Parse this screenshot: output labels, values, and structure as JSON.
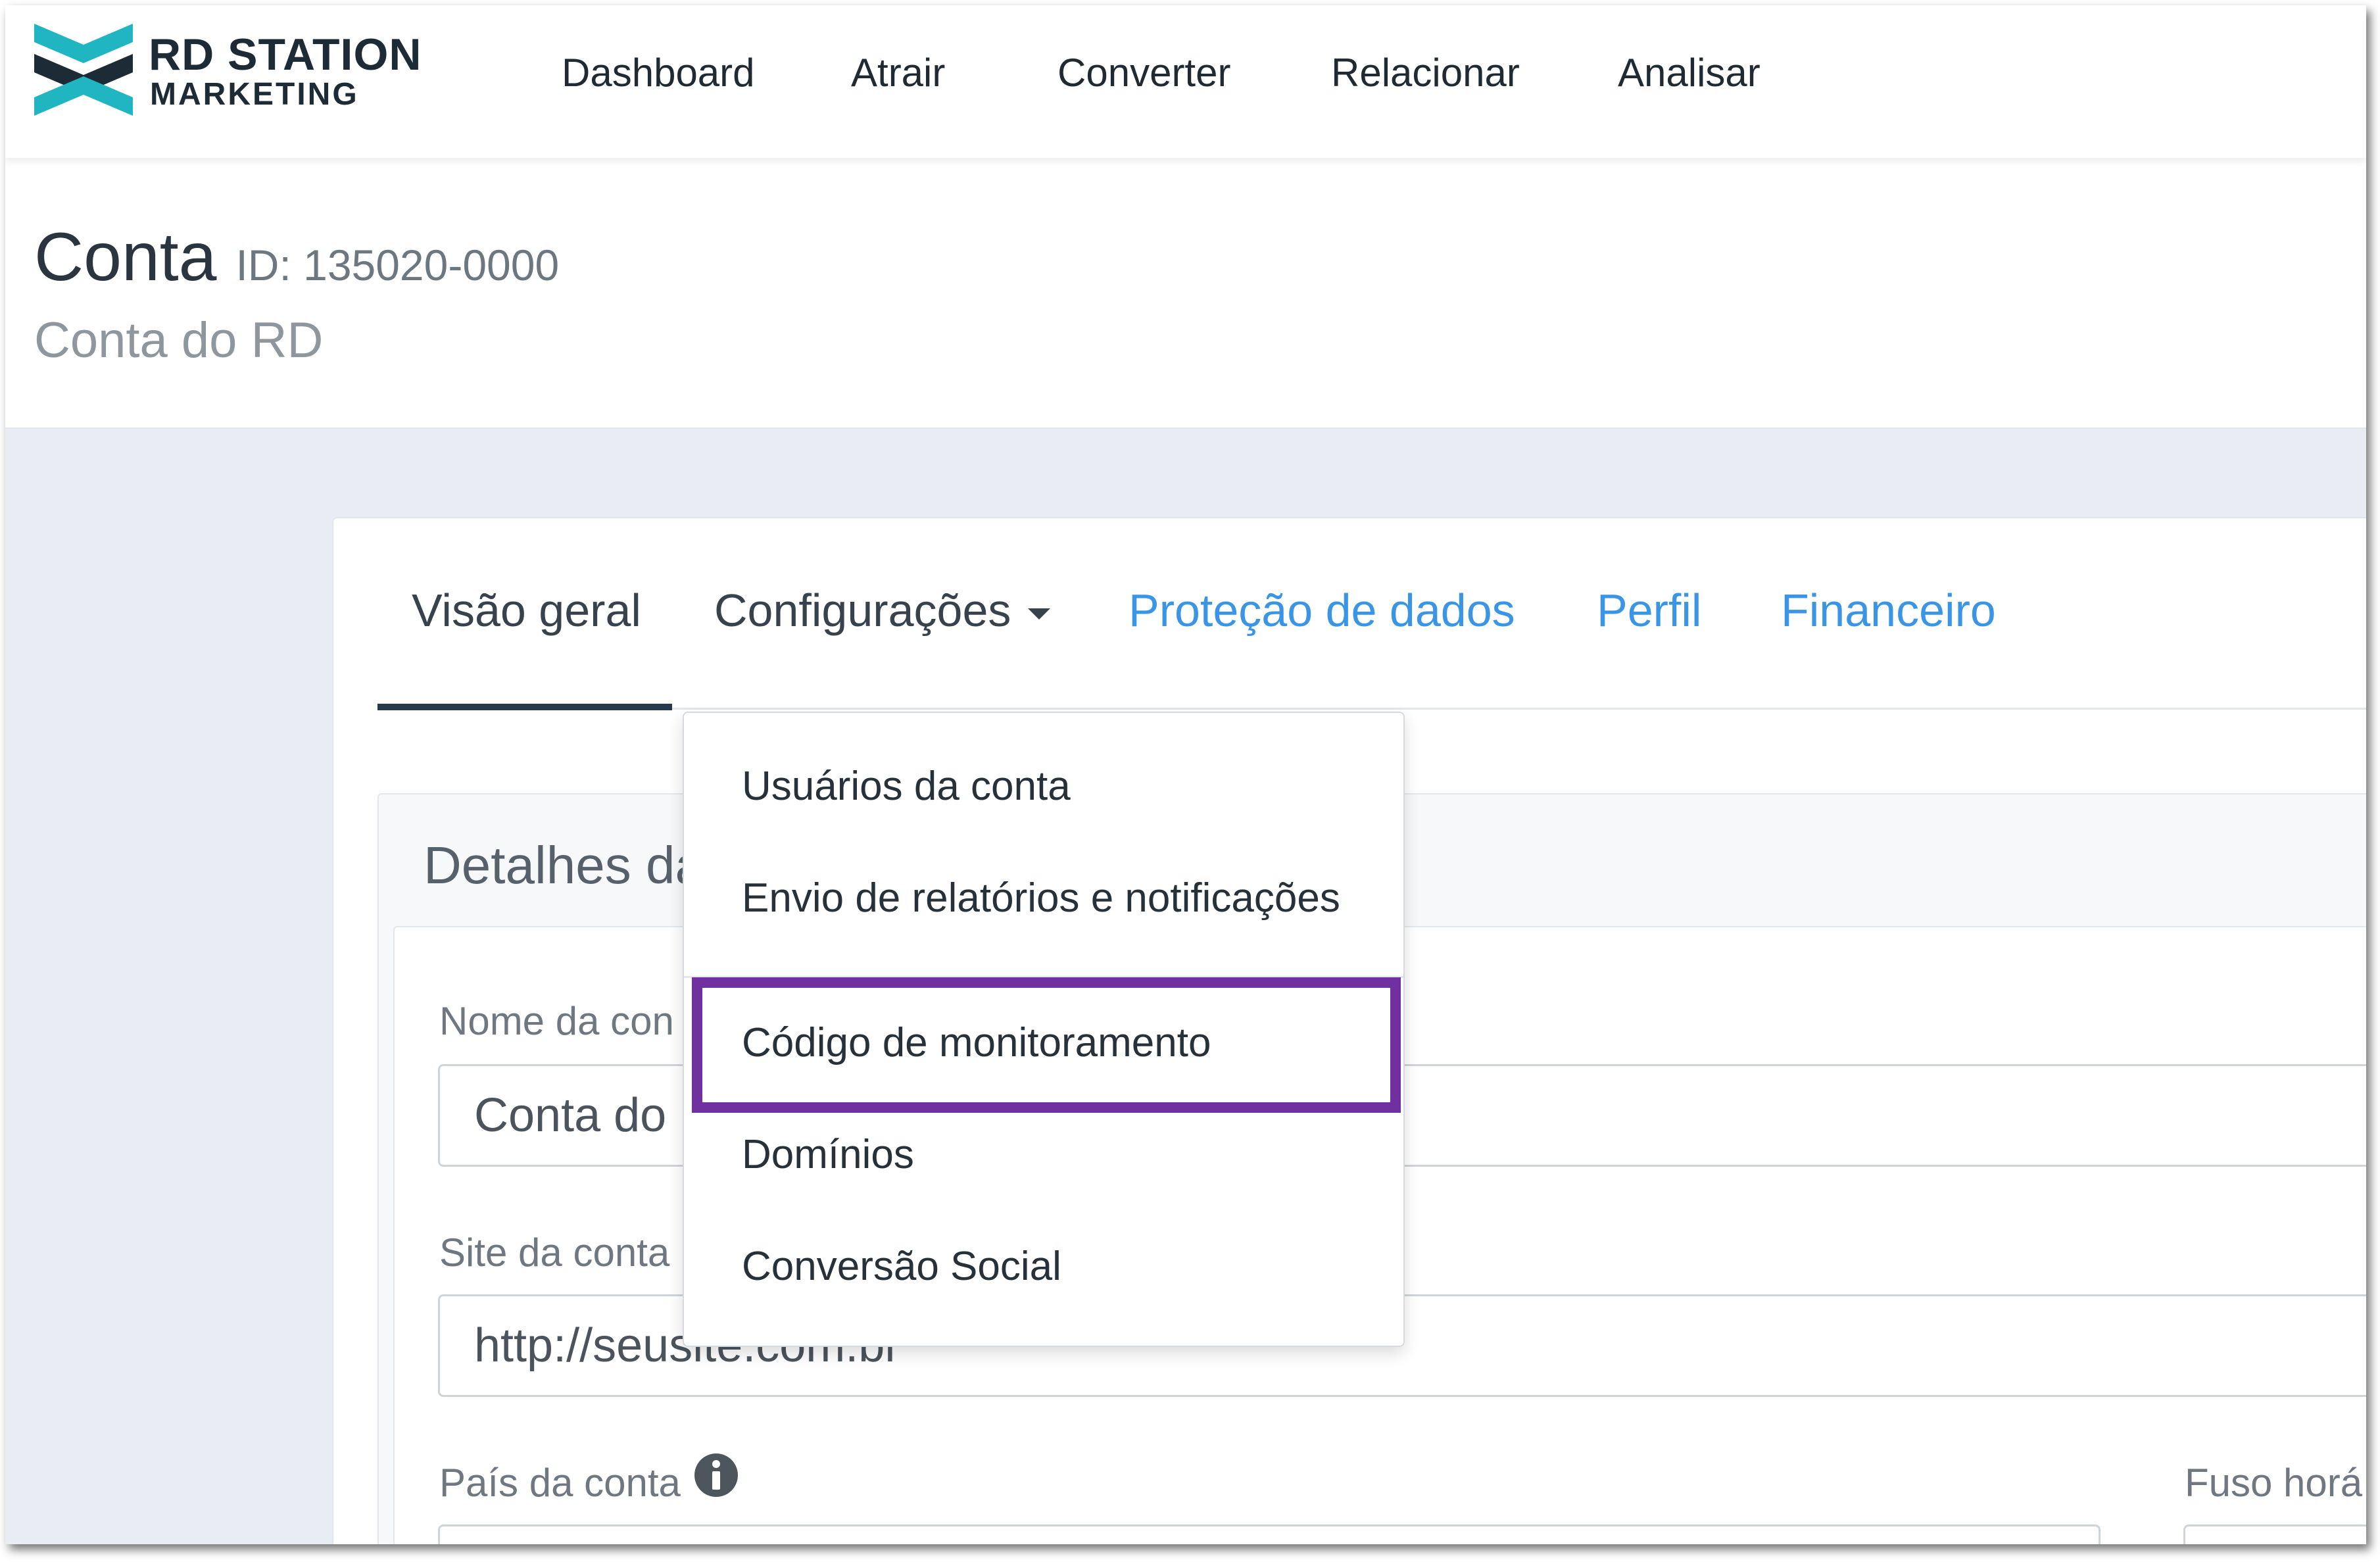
{
  "brand": {
    "line1": "RD STATION",
    "line2": "MARKETING",
    "logo_colors": [
      "#1d2b36",
      "#1fb6c1"
    ]
  },
  "topnav": {
    "items": [
      "Dashboard",
      "Atrair",
      "Converter",
      "Relacionar",
      "Analisar"
    ]
  },
  "account": {
    "title": "Conta",
    "id_text": "ID: 135020-0000",
    "subtitle": "Conta do RD"
  },
  "tabs": {
    "visao_geral": "Visão geral",
    "configuracoes": "Configurações",
    "protecao": "Proteção de dados",
    "perfil": "Perfil",
    "financeiro": "Financeiro",
    "active": "Visão geral"
  },
  "details": {
    "title": "Detalhes da",
    "nome_label": "Nome da con",
    "nome_value": "Conta do",
    "site_label": "Site da conta",
    "site_value": "http://seusite.com.br",
    "pais_label": "País da conta",
    "fuso_label": "Fuso horá"
  },
  "dropdown": {
    "items": [
      "Usuários da conta",
      "Envio de relatórios e notificações",
      "Código de monitoramento",
      "Domínios",
      "Conversão Social"
    ],
    "highlighted": "Código de monitoramento",
    "highlight_color": "#7030a0"
  },
  "colors": {
    "link": "#3a95e6",
    "tab_underline": "#27394a",
    "background": "#e9ecf2"
  }
}
